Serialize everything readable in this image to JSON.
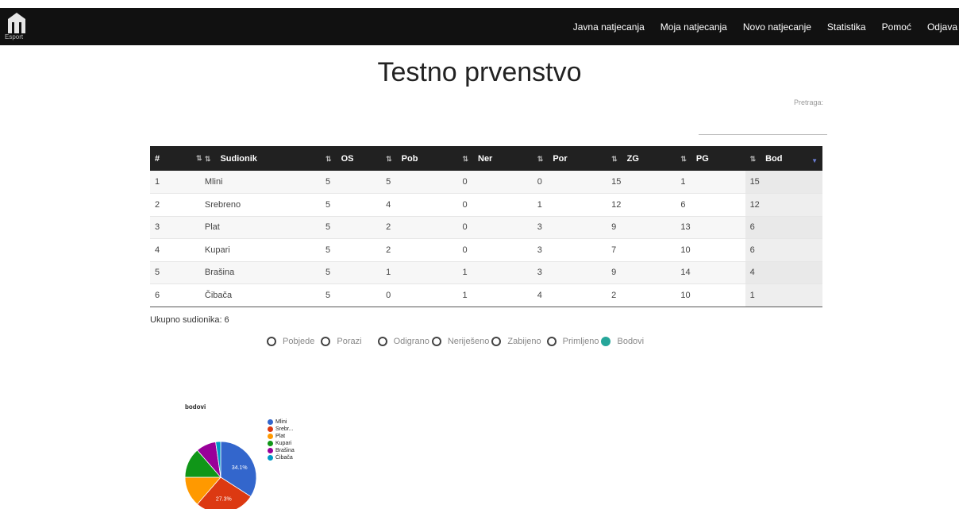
{
  "app": {
    "logo_text": "Esport"
  },
  "nav": [
    {
      "label": "Javna natjecanja"
    },
    {
      "label": "Moja natjecanja"
    },
    {
      "label": "Novo natjecanje"
    },
    {
      "label": "Statistika"
    },
    {
      "label": "Pomoć"
    },
    {
      "label": "Odjava"
    }
  ],
  "page": {
    "title": "Testno prvenstvo"
  },
  "search": {
    "label": "Pretraga:",
    "value": ""
  },
  "table": {
    "headers": [
      "#",
      "Sudionik",
      "OS",
      "Pob",
      "Ner",
      "Por",
      "ZG",
      "PG",
      "Bod"
    ],
    "rows": [
      [
        "1",
        "Mlini",
        "5",
        "5",
        "0",
        "0",
        "15",
        "1",
        "15"
      ],
      [
        "2",
        "Srebreno",
        "5",
        "4",
        "0",
        "1",
        "12",
        "6",
        "12"
      ],
      [
        "3",
        "Plat",
        "5",
        "2",
        "0",
        "3",
        "9",
        "13",
        "6"
      ],
      [
        "4",
        "Kupari",
        "5",
        "2",
        "0",
        "3",
        "7",
        "10",
        "6"
      ],
      [
        "5",
        "Brašina",
        "5",
        "1",
        "1",
        "3",
        "9",
        "14",
        "4"
      ],
      [
        "6",
        "Čibača",
        "5",
        "0",
        "1",
        "4",
        "2",
        "10",
        "1"
      ]
    ]
  },
  "total_label": "Ukupno sudionika: 6",
  "radio_options": [
    {
      "label": "Pobjede",
      "selected": false
    },
    {
      "label": "Porazi",
      "selected": false
    },
    {
      "label": "Odigrano",
      "selected": false
    },
    {
      "label": "Neriješeno",
      "selected": false
    },
    {
      "label": "Zabijeno",
      "selected": false
    },
    {
      "label": "Primljeno",
      "selected": false
    },
    {
      "label": "Bodovi",
      "selected": true
    }
  ],
  "colors": {
    "navbar": "#111111",
    "accent": "#26a69a"
  },
  "chart_data": {
    "type": "pie",
    "title": "bodovi",
    "categories": [
      "Mlini",
      "Srebr...",
      "Plat",
      "Kupari",
      "Brašina",
      "Čibača"
    ],
    "values": [
      15,
      12,
      6,
      6,
      4,
      1
    ],
    "colors": [
      "#3366cc",
      "#dc3912",
      "#ff9900",
      "#109618",
      "#990099",
      "#0099c6"
    ],
    "slice_labels": [
      "34.1%",
      "27.3%",
      "",
      "",
      "",
      ""
    ],
    "legend_position": "right"
  }
}
